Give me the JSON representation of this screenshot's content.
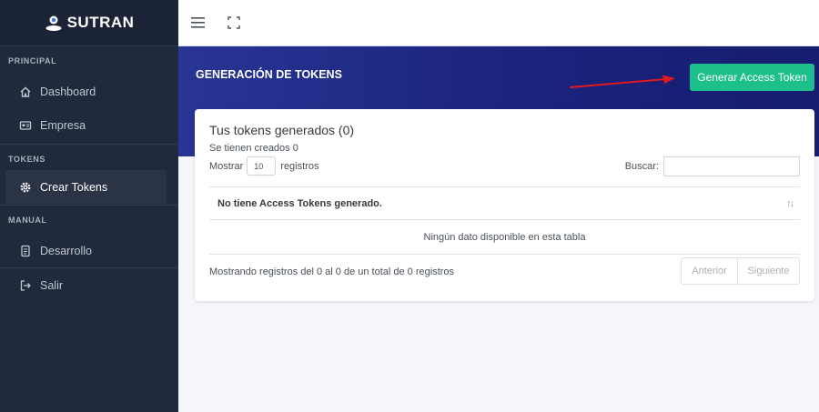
{
  "brand": {
    "name": "SUTRAN",
    "icon": "user-circle-icon"
  },
  "sidebar": {
    "sections": [
      {
        "header": "PRINCIPAL",
        "items": [
          {
            "label": "Dashboard",
            "icon": "home-icon"
          },
          {
            "label": "Empresa",
            "icon": "id-card-icon"
          }
        ]
      },
      {
        "header": "TOKENS",
        "items": [
          {
            "label": "Crear Tokens",
            "icon": "gear-icon",
            "active": true
          }
        ]
      },
      {
        "header": "MANUAL",
        "items": [
          {
            "label": "Desarrollo",
            "icon": "document-icon"
          },
          {
            "label": "Salir",
            "icon": "logout-icon"
          }
        ]
      }
    ]
  },
  "topbar": {
    "menu_icon": "hamburger-icon",
    "expand_icon": "fullscreen-icon"
  },
  "hero": {
    "title": "GENERACIÓN DE TOKENS",
    "button_label": "Generar Access Token"
  },
  "card": {
    "title": "Tus tokens generados (0)",
    "subtitle": "Se tienen creados 0",
    "show_label": "Mostrar",
    "page_size": "10",
    "records_label": "registros",
    "search_label": "Buscar:",
    "search_value": "",
    "table": {
      "column_header": "No tiene Access Tokens generado.",
      "sort_icon": "↑↓",
      "empty_message": "Ningún dato disponible en esta tabla"
    },
    "info": "Mostrando registros del 0 al 0 de un total de 0 registros",
    "pager": {
      "prev": "Anterior",
      "next": "Siguiente"
    }
  },
  "colors": {
    "sidebar": "#1f2a3d",
    "hero": "#1a237e",
    "accent": "#1dc08a",
    "arrow": "#e0191f"
  }
}
